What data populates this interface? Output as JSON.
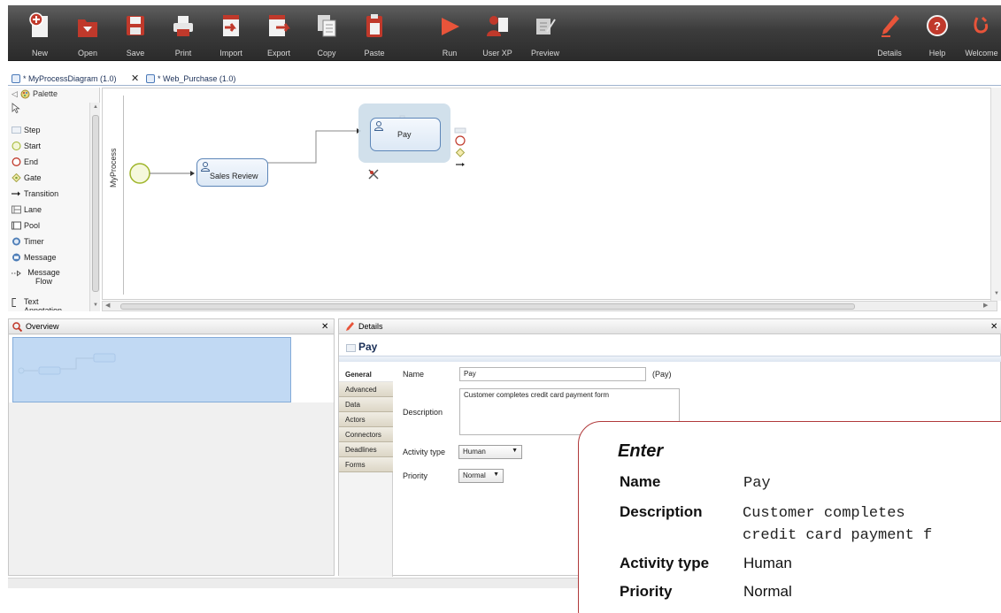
{
  "toolbar": {
    "buttons": [
      {
        "label": "New",
        "icon": "new-icon"
      },
      {
        "label": "Open",
        "icon": "open-icon"
      },
      {
        "label": "Save",
        "icon": "save-icon"
      },
      {
        "label": "Print",
        "icon": "print-icon"
      },
      {
        "label": "Import",
        "icon": "import-icon"
      },
      {
        "label": "Export",
        "icon": "export-icon"
      },
      {
        "label": "Copy",
        "icon": "copy-icon"
      },
      {
        "label": "Paste",
        "icon": "paste-icon"
      },
      {
        "label": "Run",
        "icon": "run-icon"
      },
      {
        "label": "User XP",
        "icon": "user-xp-icon"
      },
      {
        "label": "Preview",
        "icon": "preview-icon"
      },
      {
        "label": "Details",
        "icon": "details-icon"
      },
      {
        "label": "Help",
        "icon": "help-icon"
      },
      {
        "label": "Welcome",
        "icon": "welcome-icon"
      }
    ]
  },
  "tabs": [
    {
      "label": "* MyProcessDiagram (1.0)",
      "close": "✕"
    },
    {
      "label": "* Web_Purchase (1.0)"
    }
  ],
  "palette": {
    "title": "Palette",
    "items": [
      {
        "label": "Step",
        "icon": "step-icon"
      },
      {
        "label": "Start",
        "icon": "start-icon"
      },
      {
        "label": "End",
        "icon": "end-icon"
      },
      {
        "label": "Gate",
        "icon": "gate-icon"
      },
      {
        "label": "Transition",
        "icon": "transition-icon"
      },
      {
        "label": "Lane",
        "icon": "lane-icon"
      },
      {
        "label": "Pool",
        "icon": "pool-icon"
      },
      {
        "label": "Timer",
        "icon": "timer-icon"
      },
      {
        "label": "Message",
        "icon": "message-icon"
      },
      {
        "label": "Message Flow",
        "icon": "message-flow-icon"
      },
      {
        "label": "Text Annotation",
        "icon": "text-annotation-icon"
      }
    ]
  },
  "diagram": {
    "pool_label": "MyProcess",
    "tasks": [
      {
        "label": "Sales Review"
      },
      {
        "label": "Pay"
      }
    ]
  },
  "overview": {
    "title": "Overview",
    "close": "✕"
  },
  "details": {
    "header": "Details",
    "close": "✕",
    "title": "Pay",
    "tabs": [
      "General",
      "Advanced",
      "Data",
      "Actors",
      "Connectors",
      "Deadlines",
      "Forms"
    ],
    "active_tab": "General",
    "fields": {
      "name_label": "Name",
      "name_value": "Pay",
      "name_hint": "(Pay)",
      "description_label": "Description",
      "description_value": "Customer completes credit card payment form",
      "activity_type_label": "Activity type",
      "activity_type_value": "Human",
      "priority_label": "Priority",
      "priority_value": "Normal"
    }
  },
  "callout": {
    "heading": "Enter",
    "name_key": "Name",
    "name_value": "Pay",
    "description_key": "Description",
    "description_line1": "Customer completes",
    "description_line2": "credit card payment f",
    "activity_type_key": "Activity type",
    "activity_type_value": "Human",
    "priority_key": "Priority",
    "priority_value": "Normal"
  },
  "colors": {
    "toolbar_bg": "#3c3c3c",
    "accent_red": "#c0392b",
    "task_border": "#5d86b8",
    "callout_border": "#b0393a"
  }
}
